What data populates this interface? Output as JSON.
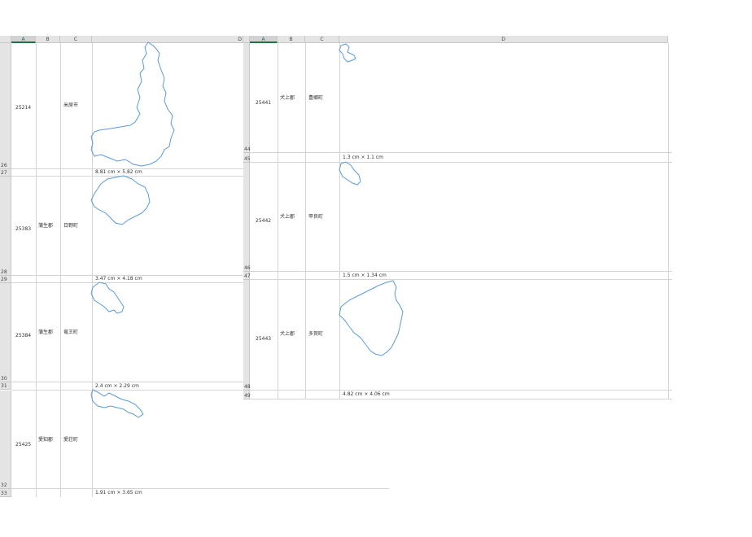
{
  "columns": {
    "a": "A",
    "b": "B",
    "c": "C",
    "d": "D"
  },
  "left_pane": {
    "rows": [
      {
        "row_num": "26",
        "code": "25214",
        "district": "",
        "municipality": "米原市",
        "dims_row": "27",
        "dims": "8.81 cm × 5.82 cm"
      },
      {
        "row_num": "28",
        "code": "25383",
        "district": "蒲生郡",
        "municipality": "日野町",
        "dims_row": "29",
        "dims": "3.47 cm × 4.18 cm"
      },
      {
        "row_num": "30",
        "code": "25384",
        "district": "蒲生郡",
        "municipality": "竜王町",
        "dims_row": "31",
        "dims": "2.4 cm × 2.29 cm"
      },
      {
        "row_num": "32",
        "code": "25425",
        "district": "愛知郡",
        "municipality": "愛荘町",
        "dims_row": "33",
        "dims": "1.91 cm × 3.65 cm"
      }
    ]
  },
  "right_pane": {
    "rows": [
      {
        "row_num": "44",
        "code": "25441",
        "district": "犬上郡",
        "municipality": "豊郷町",
        "dims_row": "45",
        "dims": "1.3 cm × 1.1 cm"
      },
      {
        "row_num": "46",
        "code": "25442",
        "district": "犬上郡",
        "municipality": "甲良町",
        "dims_row": "47",
        "dims": "1.5 cm × 1.34 cm"
      },
      {
        "row_num": "48",
        "code": "25443",
        "district": "犬上郡",
        "municipality": "多賀町",
        "dims_row": "49",
        "dims": "4.82 cm × 4.06 cm"
      }
    ]
  },
  "colors": {
    "outline": "#5b9bd5",
    "header_bg": "#e4e4e4",
    "grid": "#d4d4d4",
    "selected_header": "#217346"
  }
}
